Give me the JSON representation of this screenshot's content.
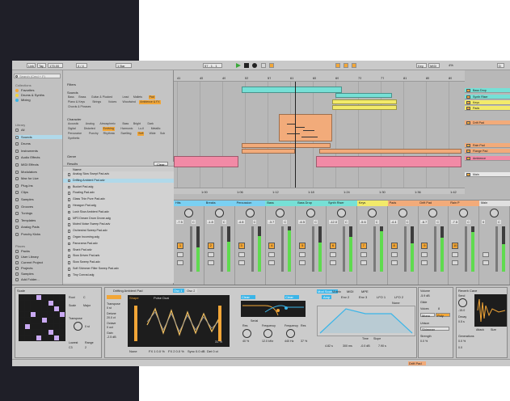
{
  "transport": {
    "link": "Link",
    "tap": "Tap",
    "bpm": "175.00",
    "meter": "4 / 4",
    "quantize": "1 Bar",
    "position": "57 . 1 . 1",
    "key": "Key",
    "midi": "MIDI",
    "cpu": "4%",
    "mode": "D"
  },
  "browser": {
    "search_placeholder": "Search (Cmd + F)",
    "collections_header": "Collections",
    "collections": [
      {
        "label": "Favorites",
        "color": "#f2a637"
      },
      {
        "label": "Drums & Synths",
        "color": "#f2d43a"
      },
      {
        "label": "Mixing",
        "color": "#3bb5e8"
      }
    ],
    "library_header": "Library",
    "library": [
      "All",
      "Sounds",
      "Drums",
      "Instruments",
      "Audio Effects",
      "MIDI Effects",
      "Modulators",
      "Max for Live",
      "Plug-Ins",
      "Clips",
      "Samples",
      "Grooves",
      "Tunings",
      "Templates",
      "Analog Pads",
      "Punchy Kicks"
    ],
    "places_header": "Places",
    "places": [
      "Packs",
      "User Library",
      "Current Project",
      "Projects",
      "Samples",
      "Add Folder..."
    ],
    "filters_label": "Filters",
    "sounds_label": "Sounds",
    "sound_chips": [
      "Bass",
      "Brass",
      "Guitar & Plucked",
      "Lead",
      "Mallets",
      "Pad",
      "Piano & Keys",
      "Strings",
      "Voices",
      "Woodwind",
      "Ambience & FX",
      "Chords & Phrases"
    ],
    "character_label": "Character",
    "character_chips": [
      "Acoustic",
      "Analog",
      "Atmospheric",
      "Bass",
      "Bright",
      "Dark",
      "Digital",
      "Distorted",
      "Evolving",
      "Harmonic",
      "Lo-fi",
      "Metallic",
      "Percussive",
      "Punchy",
      "Rhythmic",
      "Swelling",
      "Soft",
      "Wide",
      "Sub",
      "Synthetic"
    ],
    "genre_label": "Genre",
    "results_label": "Results",
    "clear_label": "Clear",
    "name_column": "Name",
    "results": [
      "Analog Slow Swept Pad.adv",
      "Drifting Ambient Pad.adv",
      "Bucket Pad.adg",
      "Floating Pad.adv",
      "Glass Thin Pure Pad.adv",
      "Hexagon Pad.adg",
      "Lush Slow Ambient Pad.adv",
      "MP3 Dream Drum Drone.adg",
      "Muted Noise Sweep Pad.adv",
      "Orchestral Sweep Pad.adv",
      "Organ Incoming.adg",
      "Panorama Pad.adv",
      "Shark Pad.adv",
      "Slow Driven Pad.adv",
      "Slow Sweep Pad.adv",
      "Soft Shimmer Filter Sweep Pad.adv",
      "Tiny Conrad.adg"
    ],
    "selected_result_index": 1
  },
  "arrangement": {
    "ruler": [
      "41",
      "45",
      "49",
      "53",
      "57",
      "61",
      "65",
      "69",
      "73",
      "77",
      "81",
      "85",
      "89"
    ],
    "time_ruler": [
      "1:00",
      "1:06",
      "1:12",
      "1:18",
      "1:24",
      "1:30",
      "1:36",
      "1:42"
    ],
    "tracks": [
      {
        "label": "Bass Drop",
        "color": "#76e0d6"
      },
      {
        "label": "Synth Riser",
        "color": "#76e0d6"
      },
      {
        "label": "Keys",
        "color": "#f2ea6a"
      },
      {
        "label": "Pads",
        "color": "#f2ea6a"
      },
      {
        "label": "Drift Pad",
        "color": "#f2ab7a"
      },
      {
        "label": "Rain Pad",
        "color": "#f2ab7a"
      },
      {
        "label": "Flange Pad",
        "color": "#f2ab7a"
      },
      {
        "label": "Ambience",
        "color": "#f28aa6"
      },
      {
        "label": "Main",
        "color": "#e8e8e8"
      }
    ]
  },
  "mixer": {
    "strips": [
      {
        "name": "Hits",
        "color": "#7ad0f2",
        "num": "1",
        "vol": "-7.5",
        "pan": "C"
      },
      {
        "name": "Breaks",
        "color": "#7ad0f2",
        "num": "2",
        "vol": "-1.8",
        "pan": "C"
      },
      {
        "name": "Percussion",
        "color": "#7ad0f2",
        "num": "3",
        "vol": "-4.8",
        "pan": "C"
      },
      {
        "name": "Bass",
        "color": "#76e0d6",
        "num": "4",
        "vol": "-3.7",
        "pan": "C"
      },
      {
        "name": "Bass Drop",
        "color": "#76e0d6",
        "num": "5",
        "vol": "-6.5",
        "pan": "C"
      },
      {
        "name": "Synth Riser",
        "color": "#76e0d6",
        "num": "6",
        "vol": "-12.0",
        "pan": "C"
      },
      {
        "name": "Keys",
        "color": "#f2ea6a",
        "num": "7",
        "vol": "-5.6",
        "pan": "C"
      },
      {
        "name": "Pads",
        "color": "#f2ab7a",
        "num": "8",
        "vol": "-4.4",
        "pan": "C"
      },
      {
        "name": "Drift Pad",
        "color": "#f2ab7a",
        "num": "9",
        "vol": "-6.7",
        "pan": "C"
      },
      {
        "name": "Rain P",
        "color": "#f2ab7a",
        "num": "10",
        "vol": "-7.5",
        "pan": "C"
      },
      {
        "name": "Main",
        "color": "#e0e0e0",
        "num": "",
        "vol": "0",
        "pan": "C"
      }
    ]
  },
  "devices": {
    "drum_title": "Scale",
    "drum_labels": {
      "root": "Root",
      "scale": "Scale",
      "transpose": "Transpose",
      "lowest": "Lowest",
      "range": "Range"
    },
    "drum_values": {
      "root": "C",
      "scale": "Major",
      "transpose": "0 st",
      "lowest": "C3",
      "range": "2"
    },
    "pad_on": [
      [
        3,
        0
      ],
      [
        5,
        1
      ],
      [
        6,
        2
      ],
      [
        2,
        3
      ],
      [
        7,
        3
      ],
      [
        4,
        4
      ],
      [
        1,
        5
      ],
      [
        5,
        6
      ],
      [
        3,
        7
      ],
      [
        6,
        7
      ]
    ],
    "synth_title": "Drifting Ambient Pad",
    "synth_tabs": [
      "Osc 1",
      "Osc 2"
    ],
    "osc_labels": {
      "wave": "Pulse Dual",
      "transpose": "Transpose",
      "detune": "Detune",
      "octave": "Octave",
      "gain": "Gain",
      "shape": "Shape"
    },
    "osc_values": {
      "transpose": "0 st",
      "detune": "20.0 ct",
      "octave": "0 oct",
      "gain": "-2.5 dB",
      "shape": "0.0 %",
      "pct": "31 %"
    },
    "osc_footer": [
      "None",
      "FX 1 0.0 %",
      "FX 2 0.0 %",
      "Sync 0.0 dB",
      "Det 0 ct"
    ],
    "filter_labels": {
      "type": "Clean",
      "serial": "Serial",
      "res": "Res",
      "frequency": "Frequency",
      "freq2": "Frequency",
      "res2": "Res"
    },
    "filter_values": {
      "res": "40 %",
      "frequency": "12.0 kHz",
      "freq2": "440 Hz",
      "res2": "37 %"
    },
    "env_tabs": [
      "Mod Sources",
      "Matrix",
      "MIDI",
      "MPE"
    ],
    "env_sub": [
      "Amp",
      "Env 2",
      "Env 3",
      "LFO 1",
      "LFO 2"
    ],
    "env_mode": "None",
    "env_time": "Time",
    "env_slope": "Slope",
    "env_values": [
      "4.82 s",
      "300 ms",
      "-0.0 dB",
      "7.90 s"
    ],
    "voice_labels": {
      "volume": "Volume",
      "glide": "Glide",
      "voices": "Voices",
      "mono": "Mono",
      "poly": "Poly",
      "unison": "Unison",
      "strength": "Strength"
    },
    "voice_values": {
      "volume": "-5.9 dB",
      "voices": "8",
      "unison": "Shimmer",
      "strength": "0.0 %"
    },
    "reverb_title": "Reverb Cave",
    "reverb_labels": {
      "send": "Send",
      "decay": "Decay",
      "attack": "Attack",
      "size": "Size",
      "generations": "Generations"
    },
    "reverb_values": {
      "send": "-15.0",
      "decay": "0.5 s",
      "pct": "0.0 %",
      "amt": "0.0"
    }
  },
  "status": {
    "track_label": "Drift Pad"
  }
}
